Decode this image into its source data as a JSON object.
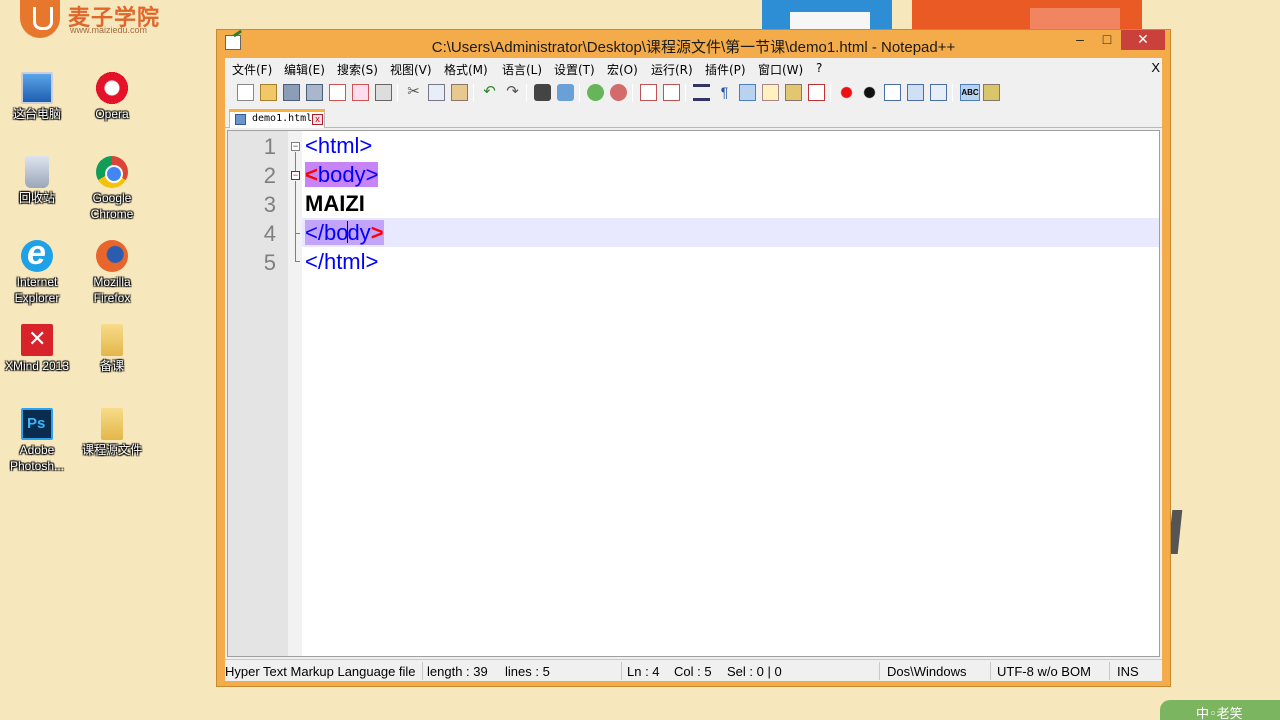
{
  "brand": {
    "name": "麦子学院",
    "url": "www.maiziedu.com"
  },
  "desktop_icons": [
    {
      "label": "这台电脑",
      "icon": "computer-icon"
    },
    {
      "label": "Opera",
      "icon": "opera-icon"
    },
    {
      "label": "回收站",
      "icon": "recycle-bin-icon"
    },
    {
      "label": "Google Chrome",
      "icon": "chrome-icon"
    },
    {
      "label": "Internet Explorer",
      "icon": "internet-explorer-icon"
    },
    {
      "label": "Mozilla Firefox",
      "icon": "firefox-icon"
    },
    {
      "label": "XMind 2013",
      "icon": "xmind-icon"
    },
    {
      "label": "备课",
      "icon": "folder-icon"
    },
    {
      "label": "Adobe Photosh...",
      "icon": "photoshop-icon"
    },
    {
      "label": "课程源文件",
      "icon": "folder-icon"
    }
  ],
  "window": {
    "title": "C:\\Users\\Administrator\\Desktop\\课程源文件\\第一节课\\demo1.html - Notepad++",
    "minimize": "–",
    "maximize": "□",
    "close": "✕"
  },
  "menu": [
    "文件(F)",
    "编辑(E)",
    "搜索(S)",
    "视图(V)",
    "格式(M)",
    "语言(L)",
    "设置(T)",
    "宏(O)",
    "运行(R)",
    "插件(P)",
    "窗口(W)",
    "?"
  ],
  "menu_close": "X",
  "tab": {
    "label": "demo1.html",
    "close": "x"
  },
  "editor": {
    "line_numbers": [
      "1",
      "2",
      "3",
      "4",
      "5"
    ],
    "lines": [
      "<html>",
      "<body>",
      "MAIZI",
      "</body>",
      "</html>"
    ],
    "current_line": 4
  },
  "status": {
    "file_type": "Hyper Text Markup Language file",
    "length": "length : 39",
    "lines": "lines : 5",
    "ln": "Ln : 4",
    "col": "Col : 5",
    "sel": "Sel : 0 | 0",
    "eol": "Dos\\Windows",
    "encoding": "UTF-8 w/o BOM",
    "mode": "INS"
  },
  "corner_text": "中◦老笑"
}
